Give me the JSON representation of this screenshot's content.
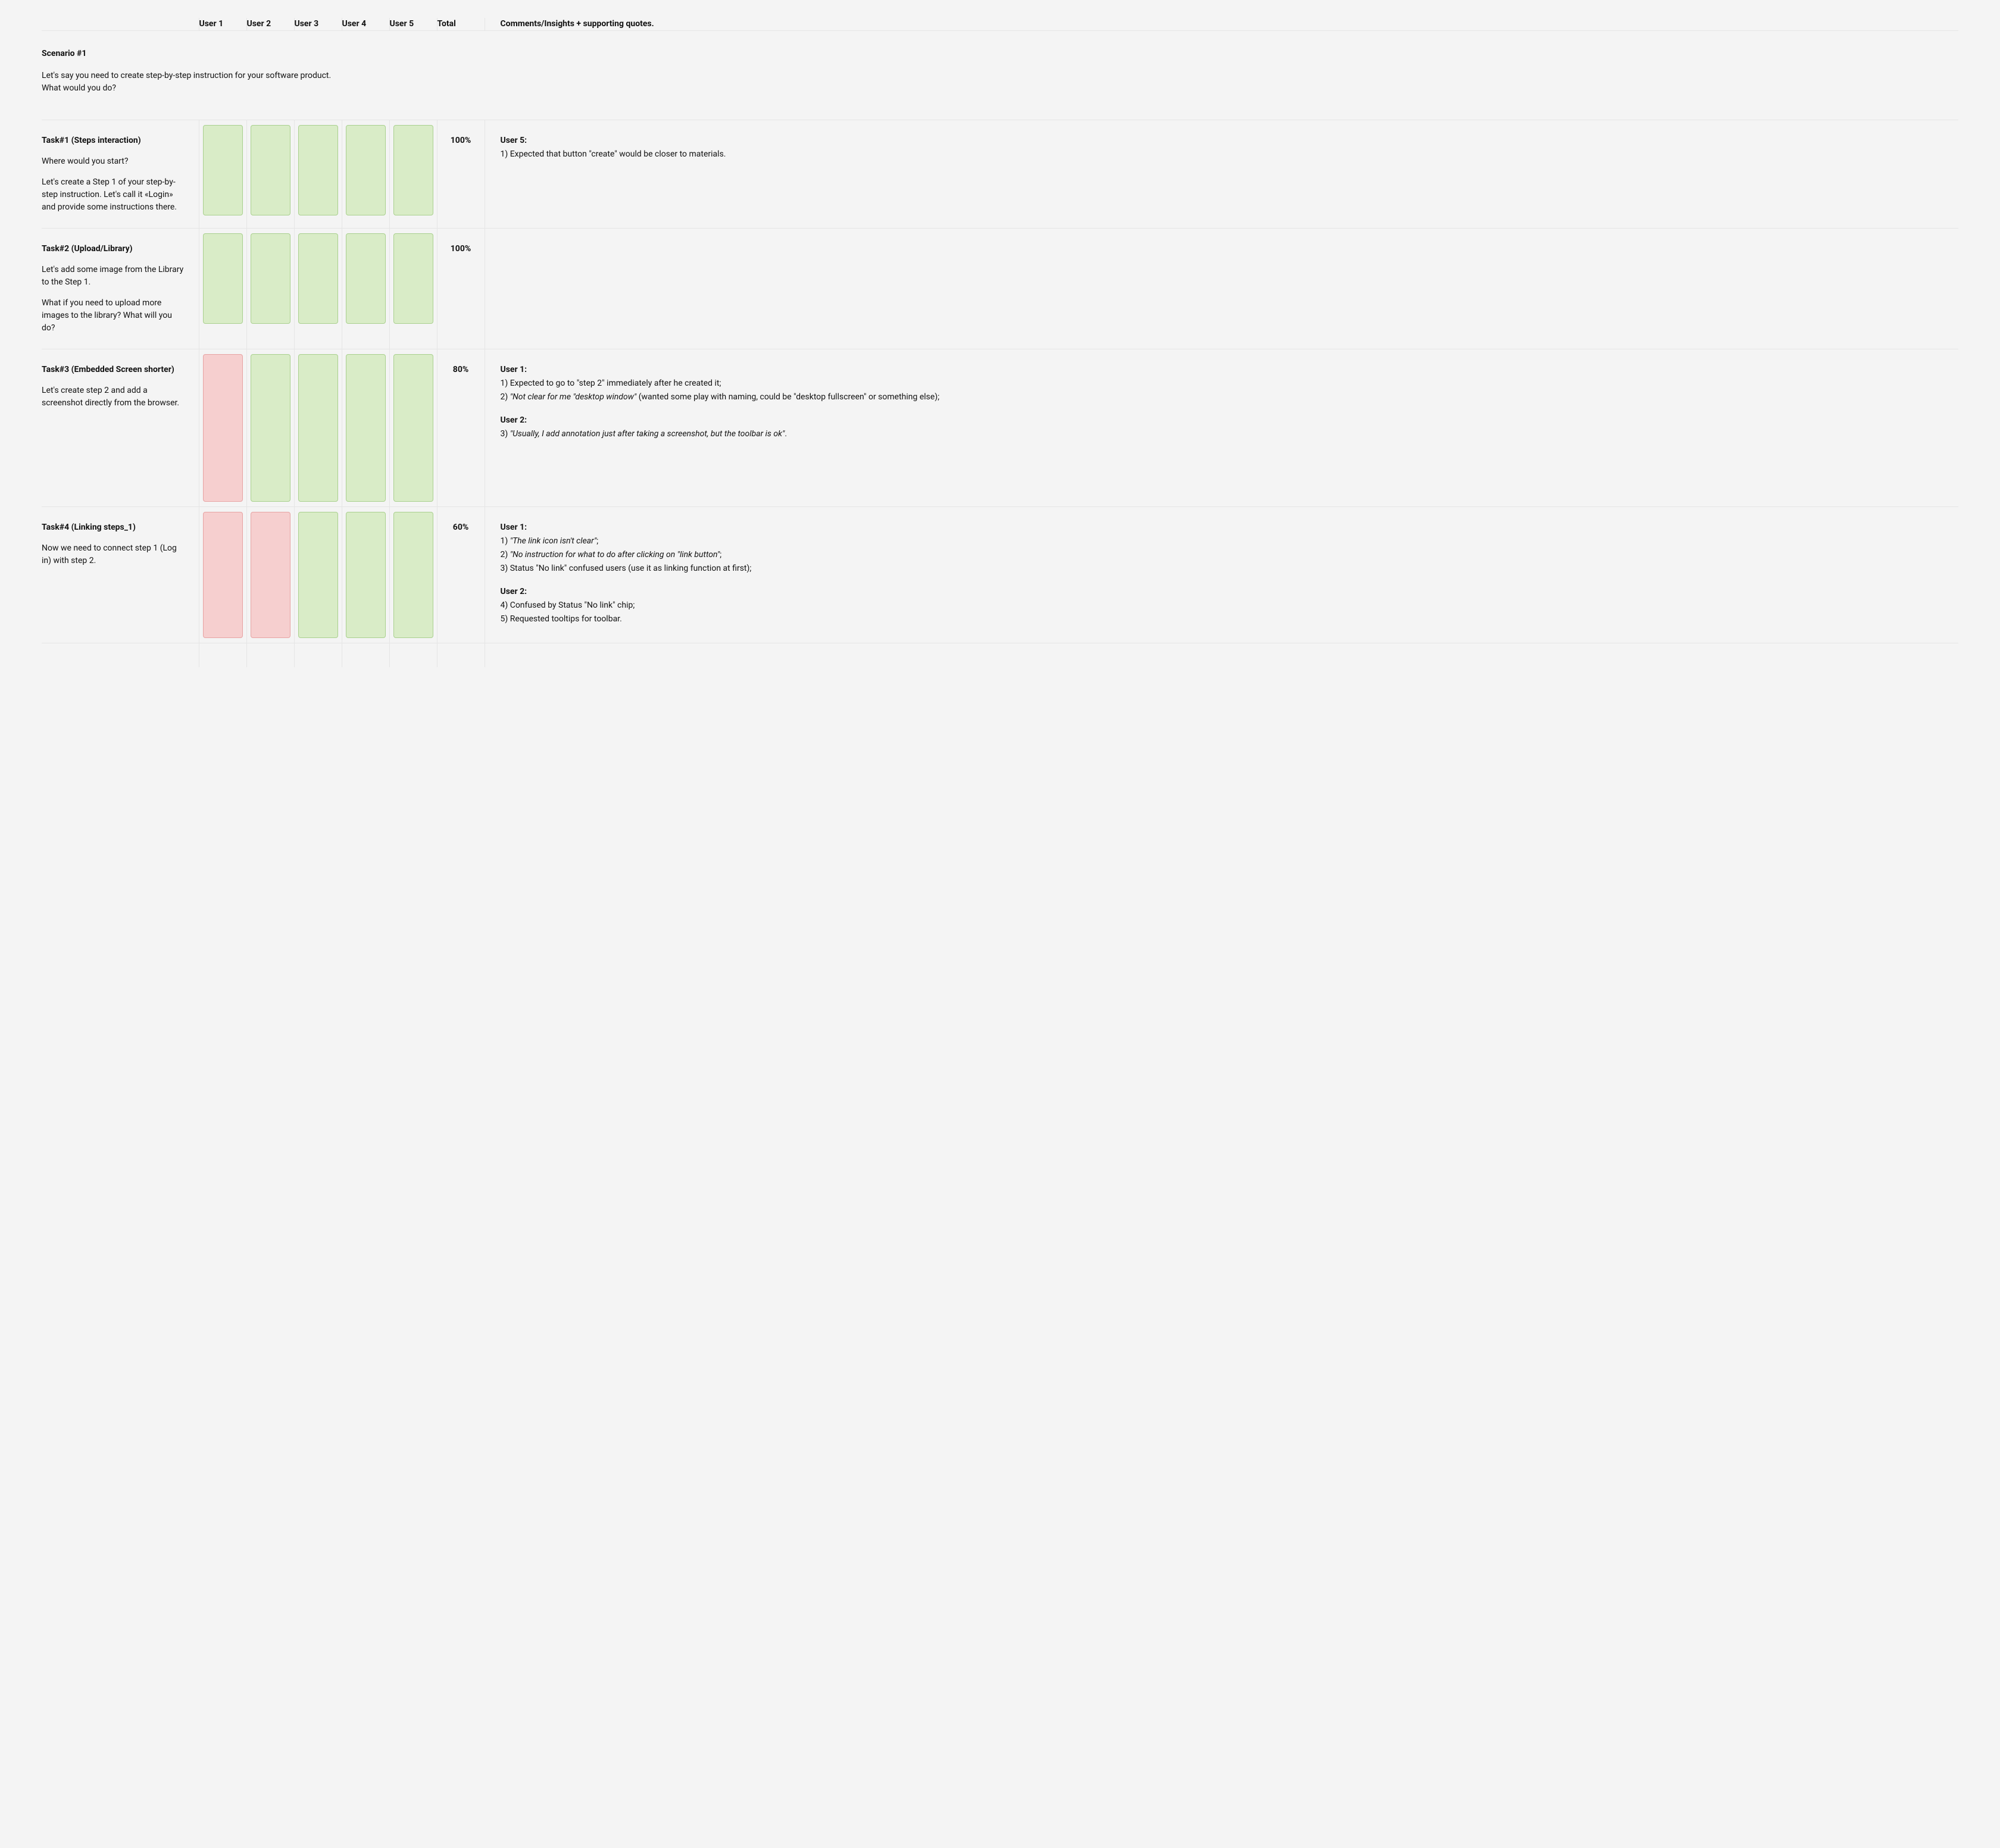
{
  "colors": {
    "ok_bg": "#d9ecc7",
    "ok_border": "#a9d08e",
    "fail_bg": "#f6cfcf",
    "fail_border": "#e7a3a3",
    "page_bg": "#f4f4f4",
    "grid_line": "#e5e5e5"
  },
  "header": {
    "first": "",
    "users": [
      "User 1",
      "User 2",
      "User 3",
      "User 4",
      "User 5"
    ],
    "total": "Total",
    "comments": "Comments/Insights + supporting quotes."
  },
  "scenario": {
    "title": "Scenario #1",
    "text": "Let's say you need to create step-by-step instruction for your software product. What would you do?"
  },
  "tasks": [
    {
      "title": "Task#1 (Steps interaction)",
      "paragraphs": [
        "Where would you start?",
        "Let's create a Step 1 of your step-by-step instruction. Let's call it «Login» and provide some instructions there."
      ],
      "results": [
        "ok",
        "ok",
        "ok",
        "ok",
        "ok"
      ],
      "swatch_height": 152,
      "total": "100%",
      "comments": [
        {
          "user": "User 5:",
          "lines": [
            {
              "text": "1) Expected that button \"create\" would be closer to materials.",
              "italic": false
            }
          ]
        }
      ]
    },
    {
      "title": "Task#2 (Upload/Library)",
      "paragraphs": [
        "Let's add some image from the Library to the Step 1.",
        "What if you need to upload more images to the library? What will you do?"
      ],
      "results": [
        "ok",
        "ok",
        "ok",
        "ok",
        "ok"
      ],
      "swatch_height": 152,
      "total": "100%",
      "comments": []
    },
    {
      "title": "Task#3 (Embedded Screen shorter)",
      "paragraphs": [
        "Let's create step 2 and add a screenshot directly from the browser."
      ],
      "results": [
        "fail",
        "ok",
        "ok",
        "ok",
        "ok"
      ],
      "swatch_height": 248,
      "total": "80%",
      "comments": [
        {
          "user": "User 1:",
          "lines": [
            {
              "text": "1) Expected to go to \"step 2\" immediately after he created it;",
              "italic": false
            },
            {
              "text": "2) \"Not clear for me \"desktop window\" (wanted some play with naming, could be \"desktop fullscreen\" or something else);",
              "italic": true,
              "italic_range": "\"Not clear for me \"desktop window\""
            }
          ]
        },
        {
          "user": "User 2:",
          "lines": [
            {
              "text": "3) \"Usually, I add annotation just after taking a screenshot, but the toolbar is ok\".",
              "italic": true,
              "italic_range": "\"Usually, I add annotation just after taking a screenshot, but the toolbar is ok\""
            }
          ]
        }
      ]
    },
    {
      "title": "Task#4 (Linking steps_1)",
      "paragraphs": [
        "Now we need to connect step 1 (Log in) with step 2."
      ],
      "results": [
        "fail",
        "fail",
        "ok",
        "ok",
        "ok"
      ],
      "swatch_height": 212,
      "total": "60%",
      "comments": [
        {
          "user": "User 1:",
          "lines": [
            {
              "text": "1) \"The link icon isn't clear\";",
              "italic": true,
              "italic_range": "\"The link icon isn't clear\""
            },
            {
              "text": "2) \"No instruction for what to do after clicking on \"link button\";",
              "italic": true,
              "italic_range": "\"No instruction for what to do after clicking on \"link button\""
            },
            {
              "text": "3) Status \"No link\" confused users (use it as linking function at first);",
              "italic": false
            }
          ]
        },
        {
          "user": "User 2:",
          "lines": [
            {
              "text": "4) Confused by Status \"No link\" chip;",
              "italic": false
            },
            {
              "text": "5) Requested tooltips for toolbar.",
              "italic": false
            }
          ]
        }
      ]
    }
  ]
}
